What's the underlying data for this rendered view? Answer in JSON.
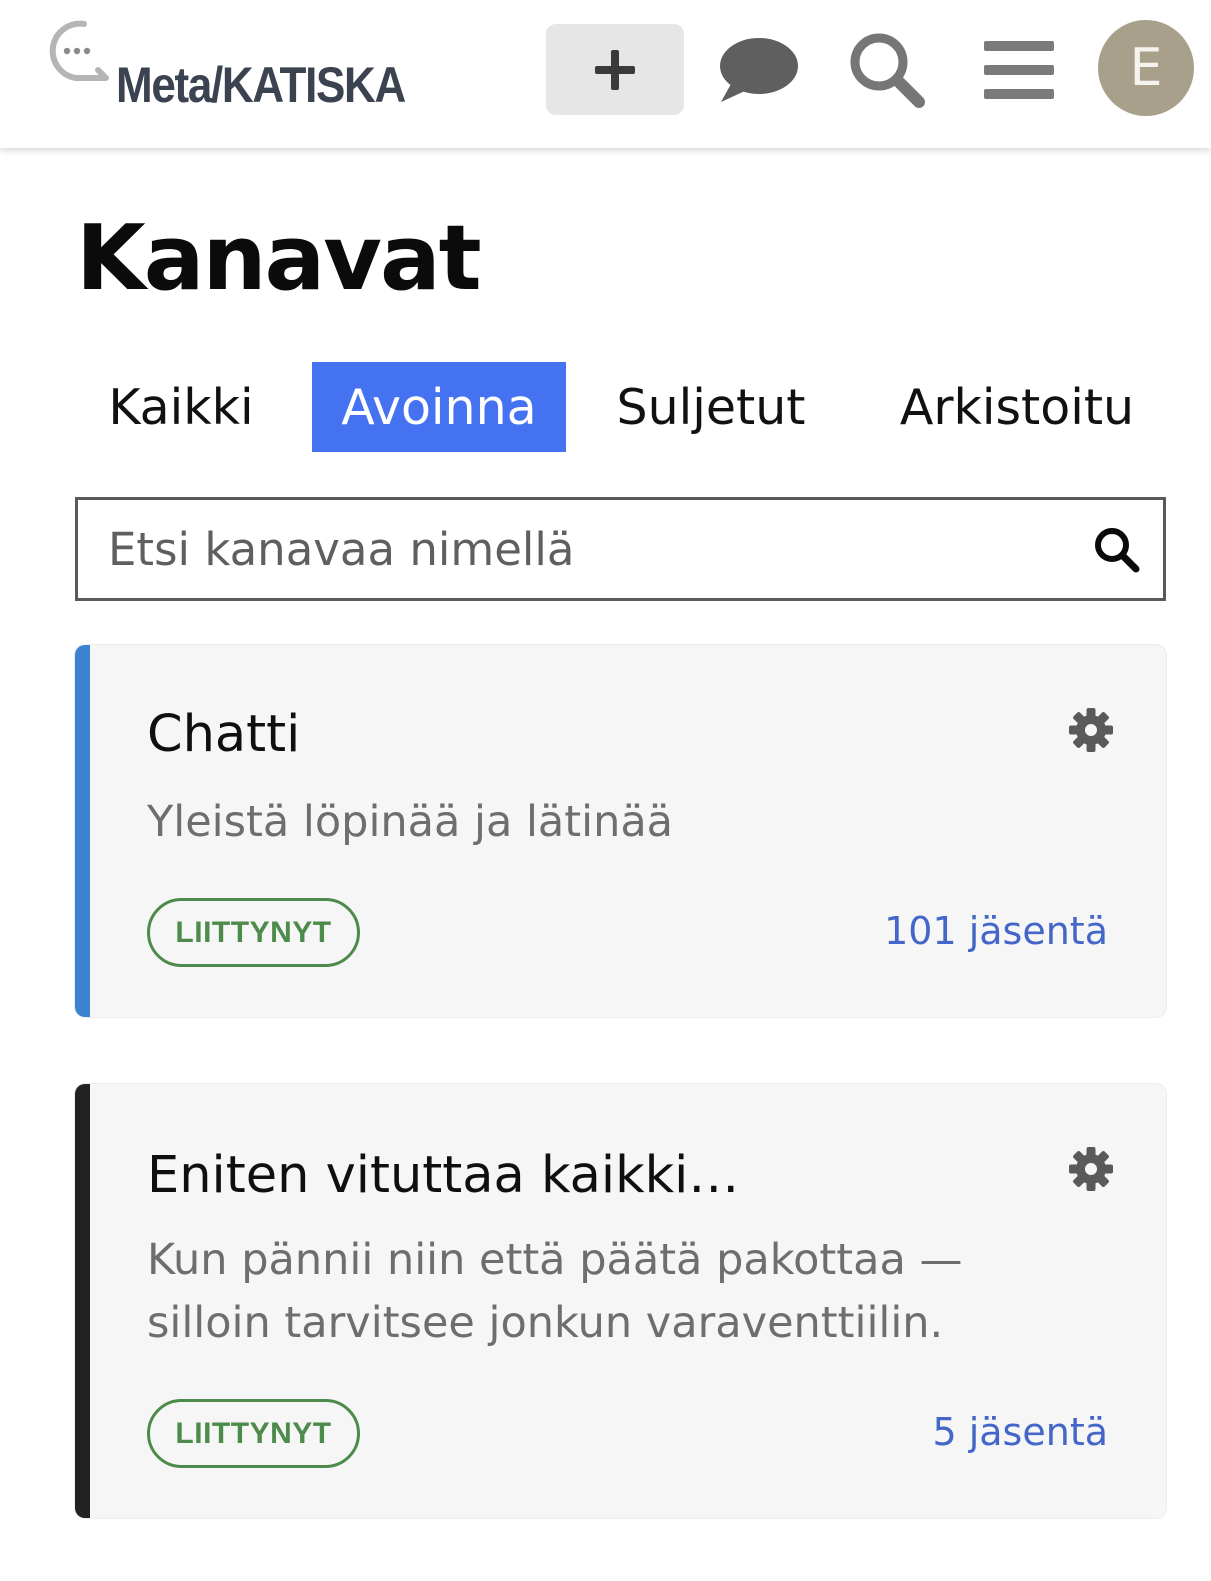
{
  "header": {
    "logo_text": "Meta/KATISKA",
    "new_button_icon": "plus-icon",
    "messages_icon": "speech-bubble-icon",
    "search_icon": "search-icon",
    "menu_icon": "hamburger-menu-icon",
    "avatar_initial": "E",
    "avatar_color": "#a8a08a"
  },
  "page": {
    "title": "Kanavat"
  },
  "tabs": [
    {
      "label": "Kaikki",
      "active": false
    },
    {
      "label": "Avoinna",
      "active": true
    },
    {
      "label": "Suljetut",
      "active": false
    },
    {
      "label": "Arkistoitu",
      "active": false
    }
  ],
  "search": {
    "placeholder": "Etsi kanavaa nimellä",
    "value": ""
  },
  "channels": [
    {
      "title": "Chatti",
      "description": "Yleistä löpinää ja lätinää",
      "badge": "LIITTYNYT",
      "members": "101 jäsentä",
      "accent_color": "#3b82d0"
    },
    {
      "title": "Eniten vituttaa kaikki…",
      "description": "Kun pännii niin että päätä pakottaa — silloin tarvitsee jonkun varaventtiilin.",
      "badge": "LIITTYNYT",
      "members": "5 jäsentä",
      "accent_color": "#222222"
    }
  ],
  "colors": {
    "active_tab": "#4472f1",
    "badge_green": "#4d8b4a",
    "member_link": "#4466c8"
  }
}
